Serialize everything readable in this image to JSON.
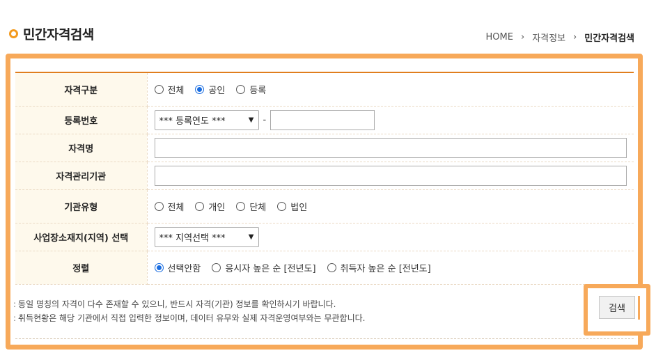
{
  "page": {
    "title": "민간자격검색"
  },
  "breadcrumb": {
    "home": "HOME",
    "sep": "›",
    "level1": "자격정보",
    "current": "민간자격검색"
  },
  "form": {
    "type": {
      "label": "자격구분",
      "options": [
        "전체",
        "공인",
        "등록"
      ],
      "selected": "공인"
    },
    "reg_no": {
      "label": "등록번호",
      "year_select": "*** 등록연도 ***",
      "dash": "-",
      "number_value": ""
    },
    "name": {
      "label": "자격명",
      "value": ""
    },
    "agency": {
      "label": "자격관리기관",
      "value": ""
    },
    "org_type": {
      "label": "기관유형",
      "options": [
        "전체",
        "개인",
        "단체",
        "법인"
      ],
      "selected": ""
    },
    "region": {
      "label": "사업장소재지(지역) 선택",
      "select": "*** 지역선택 ***"
    },
    "sort": {
      "label": "정렬",
      "options": [
        "선택안함",
        "응시자 높은 순 [전년도]",
        "취득자 높은 순 [전년도]"
      ],
      "selected": "선택안함"
    }
  },
  "notes": [
    "동일 명칭의 자격이 다수 존재할 수 있으니, 반드시 자격(기관) 정보를 확인하시기 바랍니다.",
    "취득현황은 해당 기관에서 직접 입력한 정보이며, 데이터 유무와 실제 자격운영여부와는 무관합니다."
  ],
  "search_button": "검색",
  "colors": {
    "accent": "#f39a1e",
    "frame": "#f7a95a",
    "header_bg": "#fef9ec",
    "radio_checked": "#1a6de0"
  }
}
